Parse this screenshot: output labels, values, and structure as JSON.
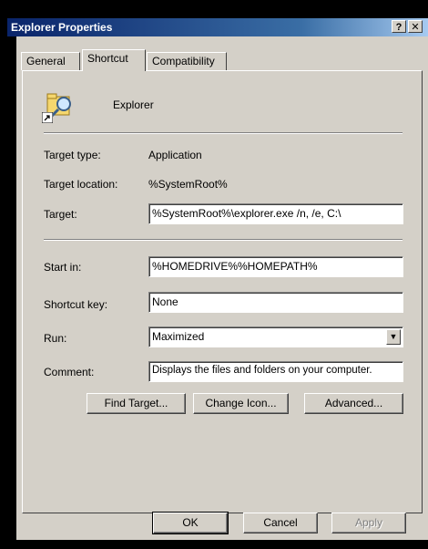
{
  "window": {
    "title": "Explorer Properties",
    "help_label": "?",
    "close_label": "✕"
  },
  "tabs": [
    {
      "label": "General"
    },
    {
      "label": "Shortcut"
    },
    {
      "label": "Compatibility"
    }
  ],
  "app_name": "Explorer",
  "props": {
    "target_type_label": "Target type:",
    "target_type_value": "Application",
    "target_location_label": "Target location:",
    "target_location_value": "%SystemRoot%",
    "target_label": "Target:",
    "target_value": "%SystemRoot%\\explorer.exe /n, /e, C:\\",
    "start_in_label": "Start in:",
    "start_in_value": "%HOMEDRIVE%%HOMEPATH%",
    "shortcut_key_label": "Shortcut key:",
    "shortcut_key_value": "None",
    "run_label": "Run:",
    "run_value": "Maximized",
    "comment_label": "Comment:",
    "comment_value": "Displays the files and folders on your computer."
  },
  "actions": {
    "find_target": "Find Target...",
    "change_icon": "Change Icon...",
    "advanced": "Advanced..."
  },
  "footer": {
    "ok": "OK",
    "cancel": "Cancel",
    "apply": "Apply"
  },
  "icons": {
    "app_icon": "folder-magnifier-icon",
    "shortcut_overlay": "shortcut-arrow-icon",
    "dropdown": "chevron-down-icon"
  }
}
